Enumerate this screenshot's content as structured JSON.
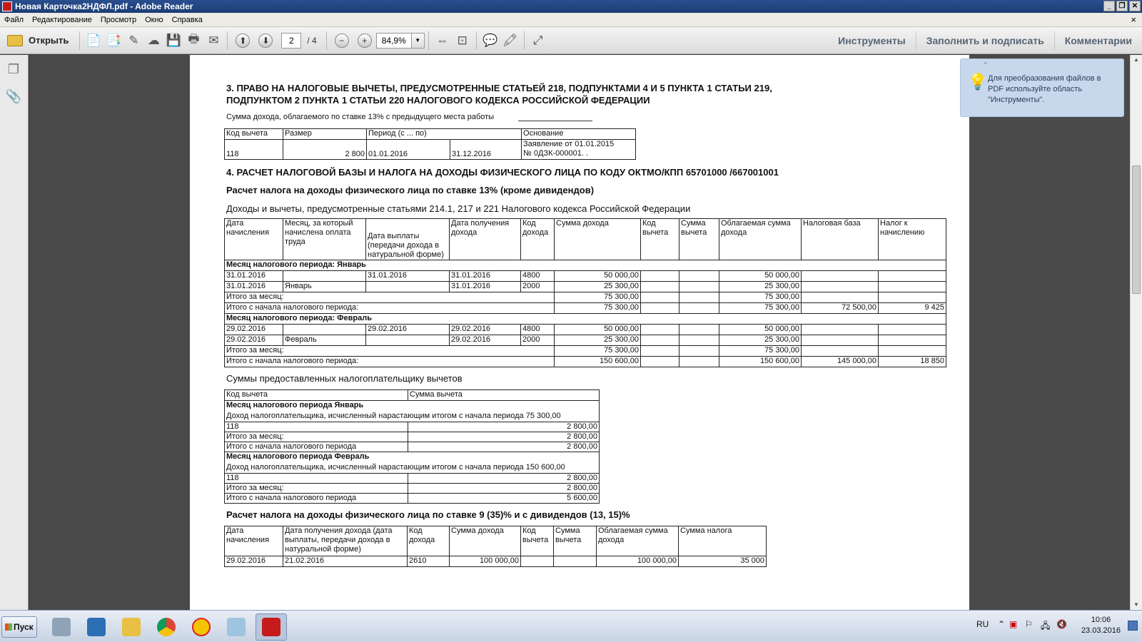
{
  "window": {
    "title": "Новая Карточка2НДФЛ.pdf - Adobe Reader"
  },
  "menu": [
    "Файл",
    "Редактирование",
    "Просмотр",
    "Окно",
    "Справка"
  ],
  "toolbar": {
    "open_label": "Открыть",
    "page_current": "2",
    "page_total": "/ 4",
    "zoom": "84,9%",
    "tools": "Инструменты",
    "fill_sign": "Заполнить и подписать",
    "comments": "Комментарии"
  },
  "tooltip": {
    "text": "Для преобразования файлов в PDF используйте область \"Инструменты\"."
  },
  "document": {
    "section3_title": "3. ПРАВО НА НАЛОГОВЫЕ ВЫЧЕТЫ, ПРЕДУСМОТРЕННЫЕ СТАТЬЕЙ  218, ПОДПУНКТАМИ 4 И 5 ПУНКТА 1 СТАТЬИ 219,",
    "section3_title2": "ПОДПУНКТОМ 2 ПУНКТА 1 СТАТЬИ 220 НАЛОГОВОГО КОДЕКСА РОССИЙСКОЙ ФЕДЕРАЦИИ",
    "prev_income_label": "Сумма дохода, облагаемого по ставке 13% с предыдущего места работы",
    "deduction_table": {
      "headers": [
        "Код вычета",
        "Размер",
        "Период (с ... по)",
        "Основание"
      ],
      "row": [
        "118",
        "2 800",
        "01.01.2016",
        "31.12.2016",
        "Заявление от 01.01.2015",
        "№ 0ДЗК-000001. ."
      ]
    },
    "section4_title": "4. РАСЧЕТ НАЛОГОВОЙ БАЗЫ И НАЛОГА НА ДОХОДЫ ФИЗИЧЕСКОГО ЛИЦА ПО КОДУ ОКТМО/КПП 65701000   /667001001",
    "calc13_title": "Расчет налога на доходы физического лица по ставке 13% (кроме дивидендов)",
    "income_subtitle": "Доходы и вычеты, предусмотренные статьями 214.1, 217 и 221 Налогового кодекса Российской Федерации",
    "main_table": {
      "headers": [
        "Дата начисления",
        "Месяц, за который начислена оплата труда",
        "Дата выплаты (передачи дохода в натуральной форме)",
        "Дата получения дохода",
        "Код дохода",
        "Сумма дохода",
        "Код вычета",
        "Сумма вычета",
        "Облагаемая сумма дохода",
        "Налоговая база",
        "Налог к начислению"
      ],
      "month_jan": "Месяц налогового периода: Январь",
      "jan_rows": [
        [
          "31.01.2016",
          "",
          "31.01.2016",
          "31.01.2016",
          "4800",
          "50 000,00",
          "",
          "",
          "50 000,00",
          "",
          ""
        ],
        [
          "31.01.2016",
          "Январь",
          "",
          "31.01.2016",
          "2000",
          "25 300,00",
          "",
          "",
          "25 300,00",
          "",
          ""
        ]
      ],
      "jan_total_month": {
        "label": "Итого за месяц:",
        "income": "75 300,00",
        "taxable": "75 300,00"
      },
      "jan_total_period": {
        "label": "Итого с начала налогового периода:",
        "income": "75 300,00",
        "taxable": "75 300,00",
        "base": "72 500,00",
        "tax": "9 425"
      },
      "month_feb": "Месяц налогового периода: Февраль",
      "feb_rows": [
        [
          "29.02.2016",
          "",
          "29.02.2016",
          "29.02.2016",
          "4800",
          "50 000,00",
          "",
          "",
          "50 000,00",
          "",
          ""
        ],
        [
          "29.02.2016",
          "Февраль",
          "",
          "29.02.2016",
          "2000",
          "25 300,00",
          "",
          "",
          "25 300,00",
          "",
          ""
        ]
      ],
      "feb_total_month": {
        "label": "Итого за месяц:",
        "income": "75 300,00",
        "taxable": "75 300,00"
      },
      "feb_total_period": {
        "label": "Итого с начала налогового периода:",
        "income": "150 600,00",
        "taxable": "150 600,00",
        "base": "145 000,00",
        "tax": "18 850"
      }
    },
    "deductions_given_title": "Суммы предоставленных налогоплательщику вычетов",
    "deductions_table": {
      "headers": [
        "Код вычета",
        "Сумма вычета"
      ],
      "jan_title": "Месяц налогового периода Январь",
      "jan_income": "Доход налогоплательщика, исчисленный нарастающим итогом с начала периода 75 300,00",
      "jan_rows": [
        [
          "118",
          "2 800,00"
        ],
        [
          "Итого за месяц:",
          "2 800,00"
        ],
        [
          "Итого с начала налогового периода",
          "2 800,00"
        ]
      ],
      "feb_title": "Месяц налогового периода Февраль",
      "feb_income": "Доход налогоплательщика, исчисленный нарастающим итогом с начала периода 150 600,00",
      "feb_rows": [
        [
          "118",
          "2 800,00"
        ],
        [
          "Итого за месяц:",
          "2 800,00"
        ],
        [
          "Итого с начала налогового периода",
          "5 600,00"
        ]
      ]
    },
    "calc9_title": "Расчет налога на доходы физического лица по ставке 9 (35)% и с дивидендов (13, 15)%",
    "div_table": {
      "headers": [
        "Дата начисления",
        "Дата получения дохода (дата выплаты, передачи дохода в натуральной форме)",
        "Код дохода",
        "Сумма дохода",
        "Код вычета",
        "Сумма вычета",
        "Облагаемая сумма дохода",
        "Сумма налога"
      ],
      "row": [
        "29.02.2016",
        "21.02.2016",
        "2610",
        "100 000,00",
        "",
        "",
        "100 000,00",
        "35 000"
      ]
    }
  },
  "taskbar": {
    "start": "Пуск",
    "lang": "RU",
    "time": "10:06",
    "date": "23.03.2016"
  }
}
